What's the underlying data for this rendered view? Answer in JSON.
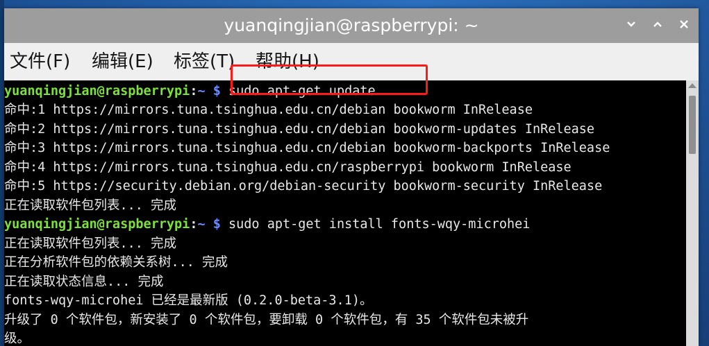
{
  "window": {
    "title": "yuanqingjian@raspberrypi: ~",
    "minimize_icon": "chevron-down-icon",
    "maximize_icon": "chevron-up-icon",
    "close_label": "×"
  },
  "menu": {
    "items": [
      {
        "label": "文件(F)"
      },
      {
        "label": "编辑(E)"
      },
      {
        "label": "标签(T)"
      },
      {
        "label": "帮助(H)"
      }
    ]
  },
  "prompt": {
    "user": "yuanqingjian@raspberrypi",
    "sep": ":",
    "path": "~",
    "dollar": " $ "
  },
  "terminal": {
    "cmd1": "sudo apt-get update",
    "out1": [
      "命中:1 https://mirrors.tuna.tsinghua.edu.cn/debian bookworm InRelease",
      "命中:2 https://mirrors.tuna.tsinghua.edu.cn/debian bookworm-updates InRelease",
      "命中:3 https://mirrors.tuna.tsinghua.edu.cn/debian bookworm-backports InRelease",
      "命中:4 https://mirrors.tuna.tsinghua.edu.cn/raspberrypi bookworm InRelease",
      "命中:5 https://security.debian.org/debian-security bookworm-security InRelease",
      "正在读取软件包列表... 完成"
    ],
    "cmd2": "sudo apt-get install fonts-wqy-microhei",
    "out2": [
      "正在读取软件包列表... 完成",
      "正在分析软件包的依赖关系树... 完成",
      "正在读取状态信息... 完成",
      "fonts-wqy-microhei 已经是最新版 (0.2.0-beta-3.1)。",
      "升级了 0 个软件包，新安装了 0 个软件包，要卸载 0 个软件包，有 35 个软件包未被升",
      "级。"
    ]
  },
  "colors": {
    "prompt_user": "#7ee03a",
    "prompt_path": "#6f8cff",
    "highlight": "#ff1a1a"
  }
}
